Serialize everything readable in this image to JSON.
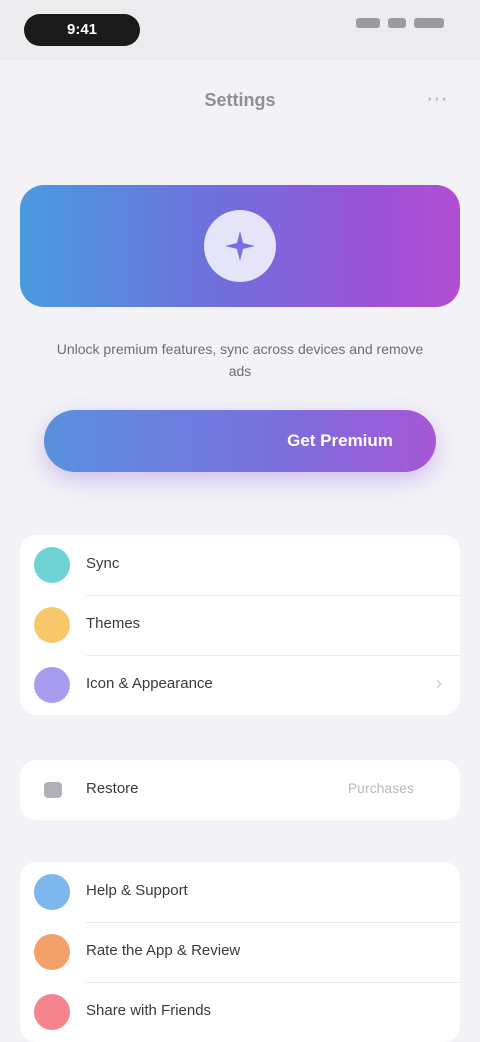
{
  "status_bar": {
    "time": "9:41"
  },
  "nav": {
    "title": "Settings",
    "action_icon": "more-icon"
  },
  "hero": {
    "icon": "sparkle-icon",
    "colors": [
      "#4a9be0",
      "#b24ed4"
    ]
  },
  "promo": {
    "description": "Unlock premium features, sync across devices and remove ads",
    "button_label": "Get Premium"
  },
  "group1": [
    {
      "label": "Sync",
      "icon_color": "#6fd3d6",
      "icon": "sync-icon"
    },
    {
      "label": "Themes",
      "icon_color": "#f6c86a",
      "icon": "palette-icon"
    },
    {
      "label": "Icon & Appearance",
      "icon_color": "#a79cee",
      "icon": "appearance-icon",
      "chevron": "›"
    }
  ],
  "group2": [
    {
      "label": "Restore",
      "value": "Purchases",
      "icon": "restore-icon"
    }
  ],
  "group3": [
    {
      "label": "Help & Support",
      "icon_color": "#7eb6ee",
      "icon": "help-icon"
    },
    {
      "label": "Rate the App & Review",
      "icon_color": "#f4a06b",
      "icon": "star-icon"
    },
    {
      "label": "Share with Friends",
      "icon_color": "#f5848f",
      "icon": "share-icon"
    }
  ]
}
